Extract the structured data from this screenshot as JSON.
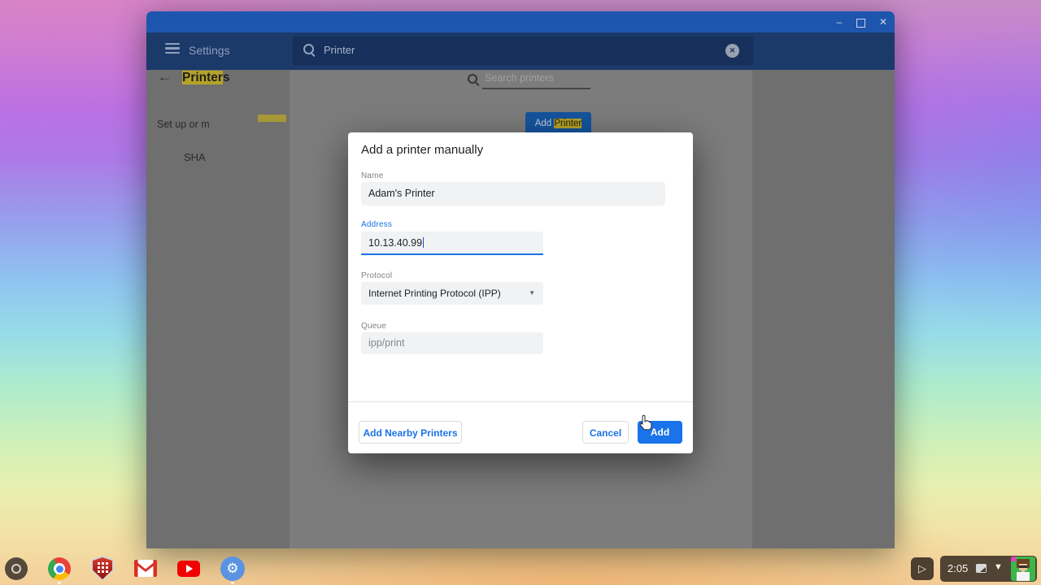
{
  "titlebar": {
    "minimize_glyph": "–",
    "close_glyph": "✕"
  },
  "toolbar": {
    "app_title": "Settings",
    "search_value": "Printer",
    "clear_glyph": "✕"
  },
  "content": {
    "back_glyph": "←",
    "heading_highlight": "Printer",
    "heading_rest": "s",
    "search_placeholder": "Search printers",
    "setup_text": "Set up or m",
    "add_button_prefix": "Add ",
    "add_button_highlight": "Printer",
    "printer_row_label": "SHA"
  },
  "dialog": {
    "title": "Add a printer manually",
    "name_label": "Name",
    "name_value": "Adam's Printer",
    "address_label": "Address",
    "address_value": "10.13.40.99",
    "protocol_label": "Protocol",
    "protocol_value": "Internet Printing Protocol (IPP)",
    "protocol_caret": "▼",
    "queue_label": "Queue",
    "queue_value": "ipp/print",
    "nearby_button": "Add Nearby Printers",
    "cancel_button": "Cancel",
    "add_button": "Add"
  },
  "shelf": {
    "play_glyph": "▷",
    "gear_glyph": "⚙",
    "time": "2:05",
    "wifi_glyph": "▼"
  },
  "colors": {
    "accent": "#1a73e8",
    "search_highlight": "#b4a328",
    "titlebar_blue": "#1e56ae",
    "toolbar_navy": "#1b3a69"
  }
}
